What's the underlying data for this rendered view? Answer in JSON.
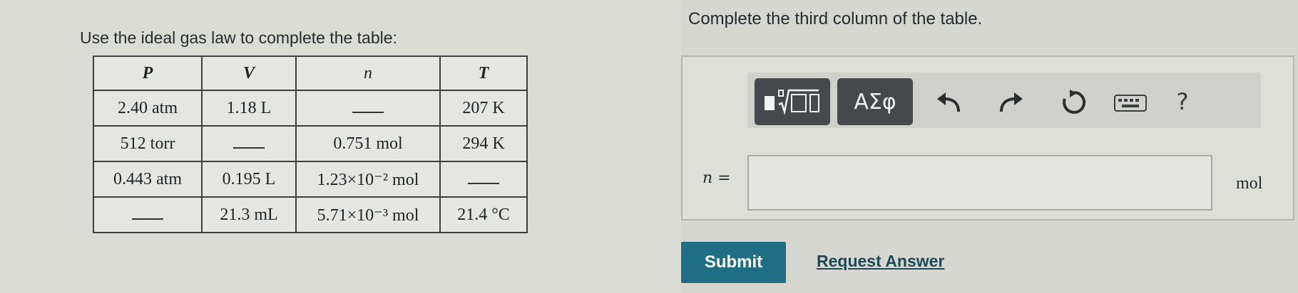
{
  "instructions": {
    "left": "Use the ideal gas law to complete the table:",
    "right": "Complete the third column of the table."
  },
  "table": {
    "headers": [
      "P",
      "V",
      "n",
      "T"
    ],
    "rows": [
      [
        "2.40 atm",
        "1.18 L",
        "",
        "207 K"
      ],
      [
        "512 torr",
        "",
        "0.751 mol",
        "294 K"
      ],
      [
        "0.443 atm",
        "0.195 L",
        "1.23×10⁻² mol",
        ""
      ],
      [
        "",
        "21.3 mL",
        "5.71×10⁻³ mol",
        "21.4 °C"
      ]
    ]
  },
  "toolbar": {
    "templates_icon": "templates-icon",
    "symbols_label": "ΑΣφ",
    "undo_icon": "undo-icon",
    "redo_icon": "redo-icon",
    "reset_icon": "reset-icon",
    "keyboard_icon": "keyboard-icon",
    "help_label": "?"
  },
  "answer": {
    "label": "n =",
    "value": "",
    "unit": "mol"
  },
  "actions": {
    "submit_label": "Submit",
    "request_answer_label": "Request Answer"
  },
  "colors": {
    "submit_bg": "#1f6f84",
    "toolbar_button_bg": "#46494b"
  }
}
